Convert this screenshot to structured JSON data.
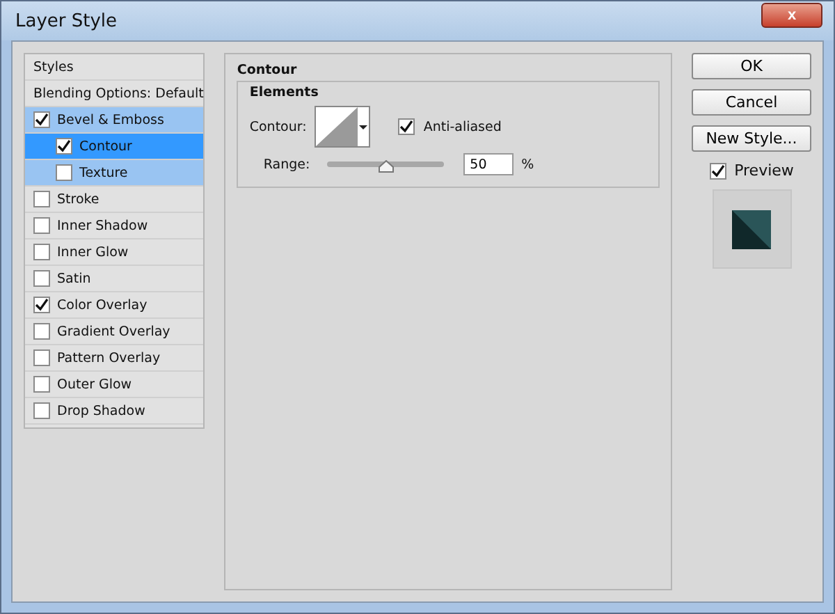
{
  "window": {
    "title": "Layer Style",
    "close": "x"
  },
  "styles": {
    "header": "Styles",
    "blending": "Blending Options: Default",
    "items": [
      {
        "label": "Bevel & Emboss",
        "checked": true,
        "selected": false,
        "children": [
          {
            "label": "Contour",
            "checked": true,
            "selected": true
          },
          {
            "label": "Texture",
            "checked": false,
            "selected": false
          }
        ]
      },
      {
        "label": "Stroke",
        "checked": false,
        "selected": false
      },
      {
        "label": "Inner Shadow",
        "checked": false,
        "selected": false
      },
      {
        "label": "Inner Glow",
        "checked": false,
        "selected": false
      },
      {
        "label": "Satin",
        "checked": false,
        "selected": false
      },
      {
        "label": "Color Overlay",
        "checked": true,
        "selected": false
      },
      {
        "label": "Gradient Overlay",
        "checked": false,
        "selected": false
      },
      {
        "label": "Pattern Overlay",
        "checked": false,
        "selected": false
      },
      {
        "label": "Outer Glow",
        "checked": false,
        "selected": false
      },
      {
        "label": "Drop Shadow",
        "checked": false,
        "selected": false
      }
    ]
  },
  "panel": {
    "title": "Contour",
    "group": "Elements",
    "contour_label": "Contour:",
    "anti_aliased": {
      "label": "Anti-aliased",
      "checked": true
    },
    "range": {
      "label": "Range:",
      "level": 0.5,
      "value": "50",
      "unit": "%"
    }
  },
  "buttons": [
    "OK",
    "Cancel",
    "New Style..."
  ],
  "preview": {
    "label": "Preview",
    "checked": true
  }
}
